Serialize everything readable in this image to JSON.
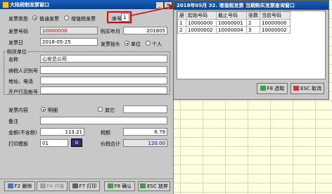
{
  "main": {
    "title": "大陆税制发票窗口",
    "invoice_type_label": "发票类型",
    "type_options": [
      "普通发票",
      "增值税发票"
    ],
    "type_selected": 0,
    "serial_label": "序号",
    "serial_value": "1",
    "invoice_no_label": "发票号码",
    "invoice_no_value": "10000000",
    "buy_year_month_label": "购买年月",
    "buy_year_month_value": "201805",
    "invoice_date_label": "发票日",
    "invoice_date_value": "2018-05-25",
    "header_label": "发票抬头",
    "header_options": [
      "单位",
      "个人"
    ],
    "header_selected": 0,
    "buyer_group_label": "购货单位",
    "name_label": "名称",
    "name_value": "心安总公司",
    "tax_id_label": "纳税人识别号",
    "tax_id_value": "",
    "address_label": "地址、电话",
    "address_value": "",
    "bank_label": "开户行及帐号",
    "bank_value": "",
    "content_label": "发票内容",
    "content_options": [
      "明细",
      "其它"
    ],
    "content_selected": 0,
    "remark_label": "备注",
    "remark_value": "",
    "amount_label": "金额(不含税)",
    "amount_value": "113.21",
    "tax_label": "税额",
    "tax_value": "6.79",
    "template_label": "打印模板",
    "template_value": "01",
    "total_label": "价税合计",
    "total_value": "120.00"
  },
  "buttons": {
    "delete": "F2 删除",
    "void": "F4 作废",
    "print": "F7 打印",
    "confirm": "F8 确认",
    "cancel": "ESC 放弃"
  },
  "popup": {
    "title": "2018年05月 32. 增值税发票 当期购买发票查询窗口",
    "columns": [
      "册",
      "起始号码",
      "截止号码",
      "张数",
      "当前号码"
    ],
    "rows": [
      [
        "1",
        "10000000",
        "10000001",
        "2",
        "10000000"
      ],
      [
        "2",
        "10000002",
        "10000004",
        "3",
        "10000002"
      ]
    ],
    "select_btn": "F8 选取",
    "cancel_btn": "ESC 取消"
  },
  "colors": {
    "title_bar": "#0b3f8a",
    "highlight_border": "#e00000",
    "invoice_no_text": "#c00000",
    "total_text": "#0000c0"
  }
}
